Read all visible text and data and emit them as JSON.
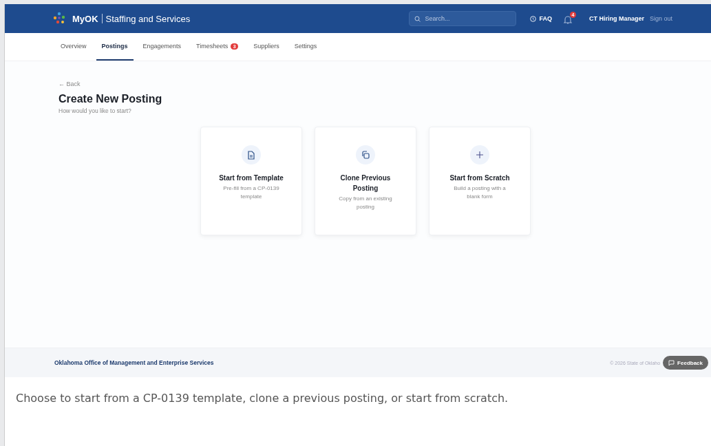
{
  "header": {
    "brand": "MyOK",
    "title": "Staffing and Services",
    "search": {
      "placeholder": "Search..."
    },
    "faq": "FAQ",
    "notifications": "4",
    "user": "CT Hiring Manager",
    "sign_out": "Sign out"
  },
  "tabs": [
    {
      "label": "Overview",
      "selected": false
    },
    {
      "label": "Postings",
      "selected": true
    },
    {
      "label": "Engagements",
      "selected": false
    },
    {
      "label": "Timesheets",
      "selected": false,
      "badge": "3"
    },
    {
      "label": "Suppliers",
      "selected": false
    },
    {
      "label": "Settings",
      "selected": false
    }
  ],
  "back": "← Back",
  "heading": "Create New Posting",
  "subheading": "How would you like to start?",
  "options": [
    {
      "kind": "template",
      "title": "Start from Template",
      "description": "Pre-fill from a CP-0139 template"
    },
    {
      "kind": "clone",
      "title": "Clone Previous Posting",
      "description": "Copy from an existing posting"
    },
    {
      "kind": "scratch",
      "title": "Start from Scratch",
      "description": "Build a posting with a blank form"
    }
  ],
  "footer": {
    "organization": "Oklahoma Office of Management and Enterprise Services",
    "copyright": "© 2026 State of Oklaho",
    "feedback": "Feedback"
  },
  "caption": "Choose to start from a CP-0139 template, clone a previous posting, or start from scratch."
}
